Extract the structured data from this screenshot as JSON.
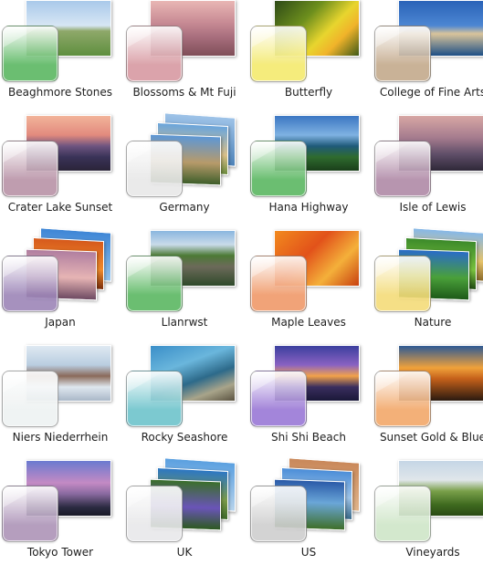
{
  "themes": [
    {
      "name": "Beaghmore Stones",
      "swatch": "#5bb862",
      "layout": "single",
      "photos": [
        "linear-gradient(180deg,#a9c9ea 0%,#d7e6f4 45%,#8fa86a 55%,#5e8f3e 100%)"
      ]
    },
    {
      "name": "Blossoms & Mt Fuji",
      "swatch": "#d89aa2",
      "layout": "single",
      "photos": [
        "linear-gradient(180deg,#e9b6b4 0%,#c78a94 40%,#a96f7e 65%,#7f4e58 100%)"
      ]
    },
    {
      "name": "Butterfly",
      "swatch": "#f4ea6e",
      "layout": "single",
      "photos": [
        "linear-gradient(135deg,#2e4a17 0%,#6d8f1d 35%,#e8d52e 60%,#f0b32a 75%,#3f5a18 100%)"
      ]
    },
    {
      "name": "College of Fine Arts",
      "swatch": "#c4aa8c",
      "layout": "single",
      "photos": [
        "linear-gradient(180deg,#2a63b8 0%,#4c86d2 45%,#d9c49b 60%,#1d4f86 100%)"
      ]
    },
    {
      "name": "Crater Lake Sunset",
      "swatch": "#b993a7",
      "layout": "single",
      "photos": [
        "linear-gradient(180deg,#f2b49a 0%,#e28a7e 35%,#6e5480 55%,#3a3358 75%,#2a2438 100%)"
      ]
    },
    {
      "name": "Germany",
      "swatch": "#e8e8e8",
      "layout": "stack",
      "photos": [
        "linear-gradient(180deg,#9ec3e8 0%,#4d82b8 100%)",
        "linear-gradient(180deg,#6aa5dc 0%,#d9c08a 60%,#6b8a3c 100%)",
        "linear-gradient(180deg,#5d97d6 0%,#b79a6a 55%,#3e5e2a 100%)"
      ]
    },
    {
      "name": "Hana Highway",
      "swatch": "#5bb862",
      "layout": "single",
      "photos": [
        "linear-gradient(180deg,#3b76c2 0%,#7fb2e2 35%,#1f5a7a 55%,#2f6b2f 75%,#1a3f1a 100%)"
      ]
    },
    {
      "name": "Isle of Lewis",
      "swatch": "#b08aa7",
      "layout": "single",
      "photos": [
        "linear-gradient(180deg,#d7a7a4 0%,#a57b8e 40%,#5f4e68 70%,#2f2838 100%)"
      ]
    },
    {
      "name": "Japan",
      "swatch": "#9d86b8",
      "layout": "stack",
      "photos": [
        "linear-gradient(180deg,#3e86d6 0%,#94c2ea 100%)",
        "linear-gradient(180deg,#d65a1c 0%,#f08a2a 60%,#7a2d0c 100%)",
        "linear-gradient(180deg,#b07ea0 0%,#e6b4b4 55%,#6e4a62 100%)"
      ]
    },
    {
      "name": "Llanrwst",
      "swatch": "#5bb862",
      "layout": "single",
      "photos": [
        "linear-gradient(180deg,#8ab6df 0%,#c9dbe9 25%,#4c7a35 45%,#6c6a5a 65%,#2f4a2a 100%)"
      ]
    },
    {
      "name": "Maple Leaves",
      "swatch": "#f09a6a",
      "layout": "single",
      "photos": [
        "linear-gradient(135deg,#f28a1e 0%,#e2521a 40%,#f4b03a 70%,#c8400f 100%)"
      ]
    },
    {
      "name": "Nature",
      "swatch": "#f4dc7a",
      "layout": "stack",
      "photos": [
        "linear-gradient(180deg,#86b8e8 0%,#e6c36a 60%,#8a6a2a 100%)",
        "linear-gradient(180deg,#3c8a2a 0%,#7ac23e 60%,#1d4a12 100%)",
        "linear-gradient(180deg,#2a6cc8 0%,#4aa03a 55%,#1d5a18 100%)"
      ]
    },
    {
      "name": "Niers Niederrhein",
      "swatch": "#eef2f2",
      "layout": "single",
      "photos": [
        "linear-gradient(180deg,#dfe9f2 0%,#b9cde0 35%,#8a6a5a 55%,#dfe7ef 75%,#aab8c8 100%)"
      ]
    },
    {
      "name": "Rocky Seashore",
      "swatch": "#6ec4cc",
      "layout": "single",
      "photos": [
        "linear-gradient(160deg,#3a8ec8 0%,#6ab6dc 35%,#2d6a8a 60%,#a8a48a 80%,#5a5240 100%)"
      ]
    },
    {
      "name": "Shi Shi Beach",
      "swatch": "#9a78d6",
      "layout": "single",
      "photos": [
        "linear-gradient(180deg,#3b3f9e 0%,#8a62c2 35%,#f2a24a 55%,#3a2e5e 75%,#1a1838 100%)"
      ]
    },
    {
      "name": "Sunset Gold & Blue",
      "swatch": "#f2a86a",
      "layout": "single",
      "photos": [
        "linear-gradient(180deg,#2e5a94 0%,#f0a23a 40%,#c4601a 60%,#2a1a10 100%)"
      ]
    },
    {
      "name": "Tokyo Tower",
      "swatch": "#ad94b8",
      "layout": "single",
      "photos": [
        "linear-gradient(180deg,#6a7ad0 0%,#c48ac4 40%,#8a6aa0 60%,#2a2a40 85%,#1a1a28 100%)"
      ]
    },
    {
      "name": "UK",
      "swatch": "#e8e8ea",
      "layout": "stack",
      "photos": [
        "linear-gradient(180deg,#5ba0e0 0%,#b8d4ec 100%)",
        "linear-gradient(180deg,#2d77c4 0%,#7a9a4a 60%,#3e6a2a 100%)",
        "linear-gradient(180deg,#3a6f2a 0%,#6a54b8 55%,#2d5a20 100%)"
      ]
    },
    {
      "name": "US",
      "swatch": "#cfcfcf",
      "layout": "stack",
      "photos": [
        "linear-gradient(180deg,#c9885a 0%,#e0b48a 100%)",
        "linear-gradient(180deg,#4c8ed8 0%,#9ec4e8 55%,#3a6a8a 100%)",
        "linear-gradient(180deg,#2a5aa8 0%,#6aa6d8 45%,#3f6f2a 100%)"
      ]
    },
    {
      "name": "Vineyards",
      "swatch": "#cfe6c8",
      "layout": "single",
      "photos": [
        "linear-gradient(180deg,#c5d6e6 0%,#e0e6ea 35%,#7aa04a 55%,#3f6a1f 80%,#2a4a14 100%)"
      ]
    }
  ]
}
